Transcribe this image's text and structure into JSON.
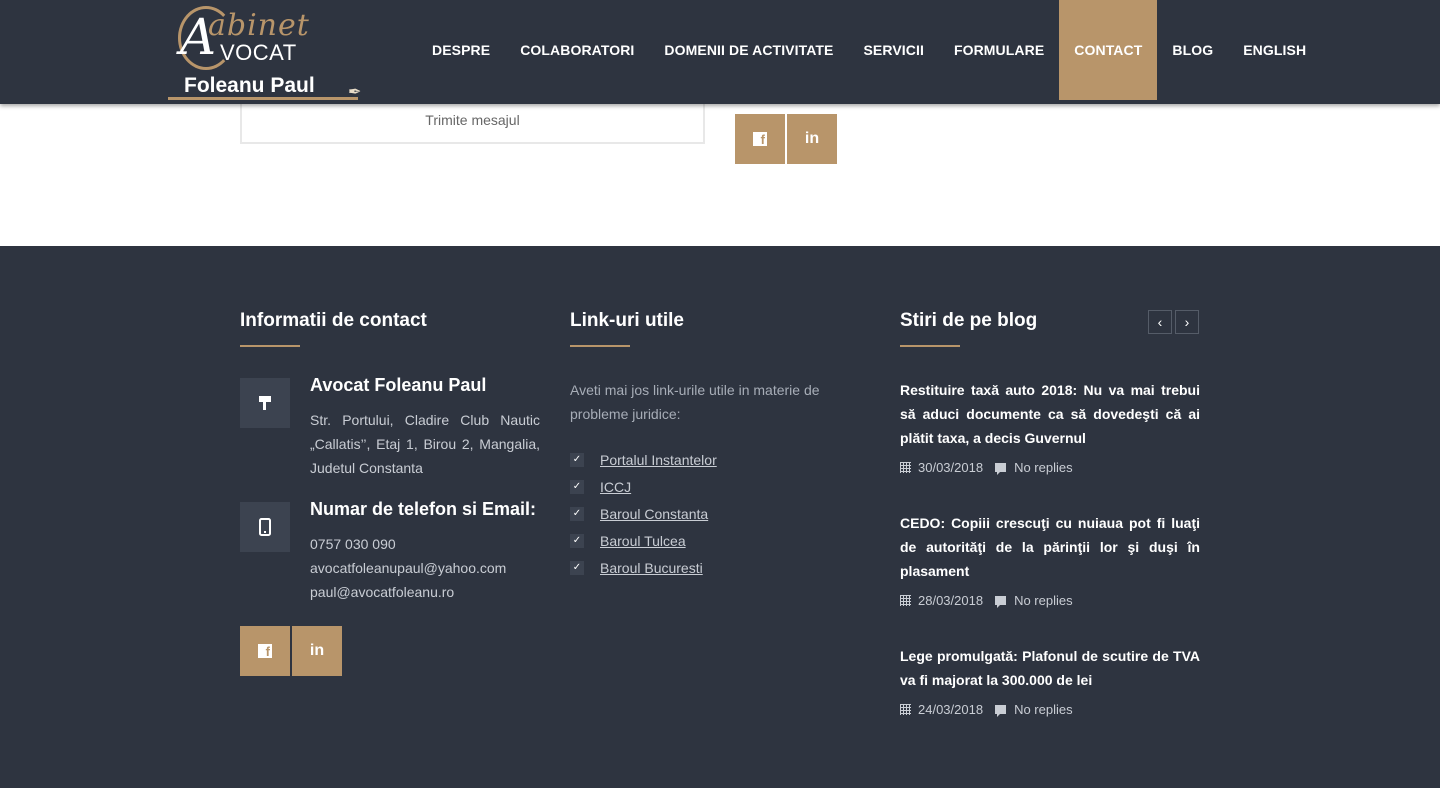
{
  "logo": {
    "script_text": "abinet",
    "letter": "A",
    "avocat": "VOCAT",
    "name": "Foleanu Paul"
  },
  "nav": {
    "items": [
      {
        "label": "DESPRE"
      },
      {
        "label": "COLABORATORI"
      },
      {
        "label": "DOMENII DE ACTIVITATE"
      },
      {
        "label": "SERVICII"
      },
      {
        "label": "FORMULARE"
      },
      {
        "label": "CONTACT",
        "active": true
      },
      {
        "label": "BLOG"
      },
      {
        "label": "ENGLISH"
      }
    ]
  },
  "form": {
    "submit_label": "Trimite mesajul"
  },
  "social": {
    "facebook_icon": "facebook-icon",
    "linkedin_icon": "linkedin-icon",
    "facebook_glyph": "f",
    "linkedin_glyph": "in"
  },
  "footer": {
    "contact": {
      "title": "Informatii de contact",
      "office_title": "Avocat Foleanu Paul",
      "address": "Str. Portului, Cladire Club Nautic „Callatis’’, Etaj 1, Birou 2, Mangalia, Judetul Constanta",
      "phone_title": "Numar de telefon si Email:",
      "phone": "0757 030 090",
      "email1": "avocatfoleanupaul@yahoo.com",
      "email2": "paul@avocatfoleanu.ro"
    },
    "links": {
      "title": "Link-uri utile",
      "intro": "Aveti mai jos link-urile utile in materie de probleme juridice:",
      "items": [
        {
          "label": "Portalul Instantelor"
        },
        {
          "label": "ICCJ"
        },
        {
          "label": "Baroul Constanta"
        },
        {
          "label": "Baroul Tulcea"
        },
        {
          "label": "Baroul Bucuresti"
        }
      ]
    },
    "blog": {
      "title": "Stiri de pe blog",
      "prev": "‹",
      "next": "›",
      "posts": [
        {
          "title": "Restituire taxă auto 2018: Nu va mai trebui să aduci documente ca să dovedeşti că ai plătit taxa, a decis Guvernul",
          "date": "30/03/2018",
          "replies": "No replies"
        },
        {
          "title": "CEDO: Copiii crescuţi cu nuiaua pot fi luaţi de autorităţi de la părinţii lor şi duşi în plasament",
          "date": "28/03/2018",
          "replies": "No replies"
        },
        {
          "title": "Lege promulgată: Plafonul de scutire de TVA va fi majorat la 300.000 de lei",
          "date": "24/03/2018",
          "replies": "No replies"
        }
      ]
    }
  },
  "colors": {
    "header_bg": "#2e3440",
    "accent": "#b8956a",
    "footer_bg": "#2e3440"
  }
}
